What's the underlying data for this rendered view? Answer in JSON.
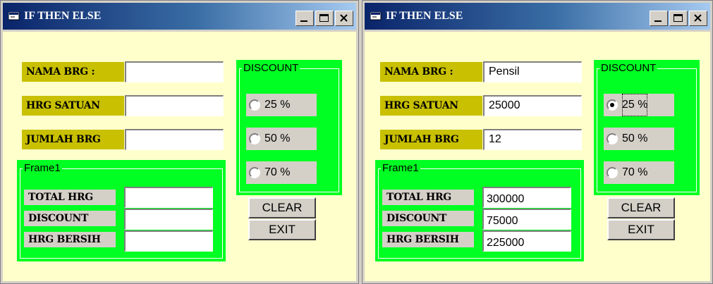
{
  "window_left": {
    "title": "IF THEN ELSE",
    "fields": {
      "nama_label": "NAMA BRG :",
      "nama_value": "",
      "harga_label": "HRG SATUAN",
      "harga_value": "",
      "jumlah_label": "JUMLAH BRG",
      "jumlah_value": ""
    },
    "discount_frame": {
      "title": "DISCOUNT",
      "options": [
        {
          "label": "25 %",
          "selected": false
        },
        {
          "label": "50 %",
          "selected": false
        },
        {
          "label": "70 %",
          "selected": false
        }
      ]
    },
    "result_frame": {
      "title": "Frame1",
      "rows": [
        {
          "label": "TOTAL HRG",
          "value": ""
        },
        {
          "label": "DISCOUNT",
          "value": ""
        },
        {
          "label": "HRG BERSIH",
          "value": ""
        }
      ]
    },
    "buttons": {
      "clear": "CLEAR",
      "exit": "EXIT"
    }
  },
  "window_right": {
    "title": "IF THEN ELSE",
    "fields": {
      "nama_label": "NAMA BRG :",
      "nama_value": "Pensil",
      "harga_label": "HRG SATUAN",
      "harga_value": "25000",
      "jumlah_label": "JUMLAH BRG",
      "jumlah_value": "12"
    },
    "discount_frame": {
      "title": "DISCOUNT",
      "options": [
        {
          "label": "25 %",
          "selected": true
        },
        {
          "label": "50 %",
          "selected": false
        },
        {
          "label": "70 %",
          "selected": false
        }
      ]
    },
    "result_frame": {
      "title": "Frame1",
      "rows": [
        {
          "label": "TOTAL HRG",
          "value": "300000"
        },
        {
          "label": "DISCOUNT",
          "value": "75000"
        },
        {
          "label": "HRG BERSIH",
          "value": "225000"
        }
      ]
    },
    "buttons": {
      "clear": "CLEAR",
      "exit": "EXIT"
    }
  },
  "colors": {
    "form_background": "#ffffcc",
    "label_background": "#c8c000",
    "frame_background": "#00ff22",
    "titlebar_start": "#0a246a",
    "titlebar_end": "#a6caf0"
  },
  "icons": {
    "app": "vb-form-icon",
    "minimize": "minimize-icon",
    "maximize": "maximize-icon",
    "close": "close-icon"
  }
}
